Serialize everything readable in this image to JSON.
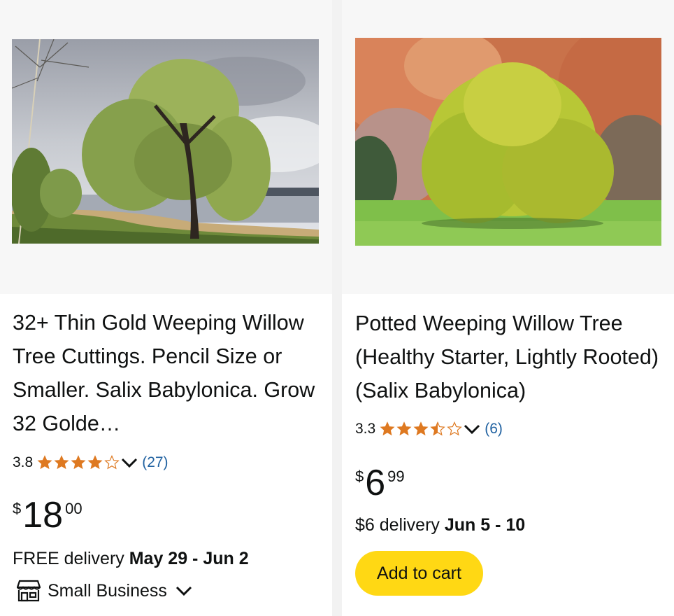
{
  "products": [
    {
      "title": "32+ Thin Gold Weeping Willow Tree Cuttings. Pencil Size or Smaller. Salix Babylonica. Grow 32 Golde…",
      "rating_value": "3.8",
      "rating_stars": 3.8,
      "review_count": "(27)",
      "price_symbol": "$",
      "price_whole": "18",
      "price_fraction": "00",
      "delivery_prefix": "FREE delivery ",
      "delivery_dates": "May 29 - Jun 2",
      "badge_label": "Small Business",
      "image_icon": "weeping-willow-lakeside-photo"
    },
    {
      "title": "Potted Weeping Willow Tree (Healthy Starter, Lightly Rooted)(Salix Babylonica)",
      "rating_value": "3.3",
      "rating_stars": 3.3,
      "review_count": "(6)",
      "price_symbol": "$",
      "price_whole": "6",
      "price_fraction": "99",
      "delivery_prefix": "$6 delivery ",
      "delivery_dates": "Jun 5 - 10",
      "cart_label": "Add to cart",
      "image_icon": "weeping-willow-park-photo"
    }
  ],
  "colors": {
    "star": "#de7921",
    "link": "#2162a1",
    "cart_button": "#ffd814",
    "text": "#0f1111"
  }
}
